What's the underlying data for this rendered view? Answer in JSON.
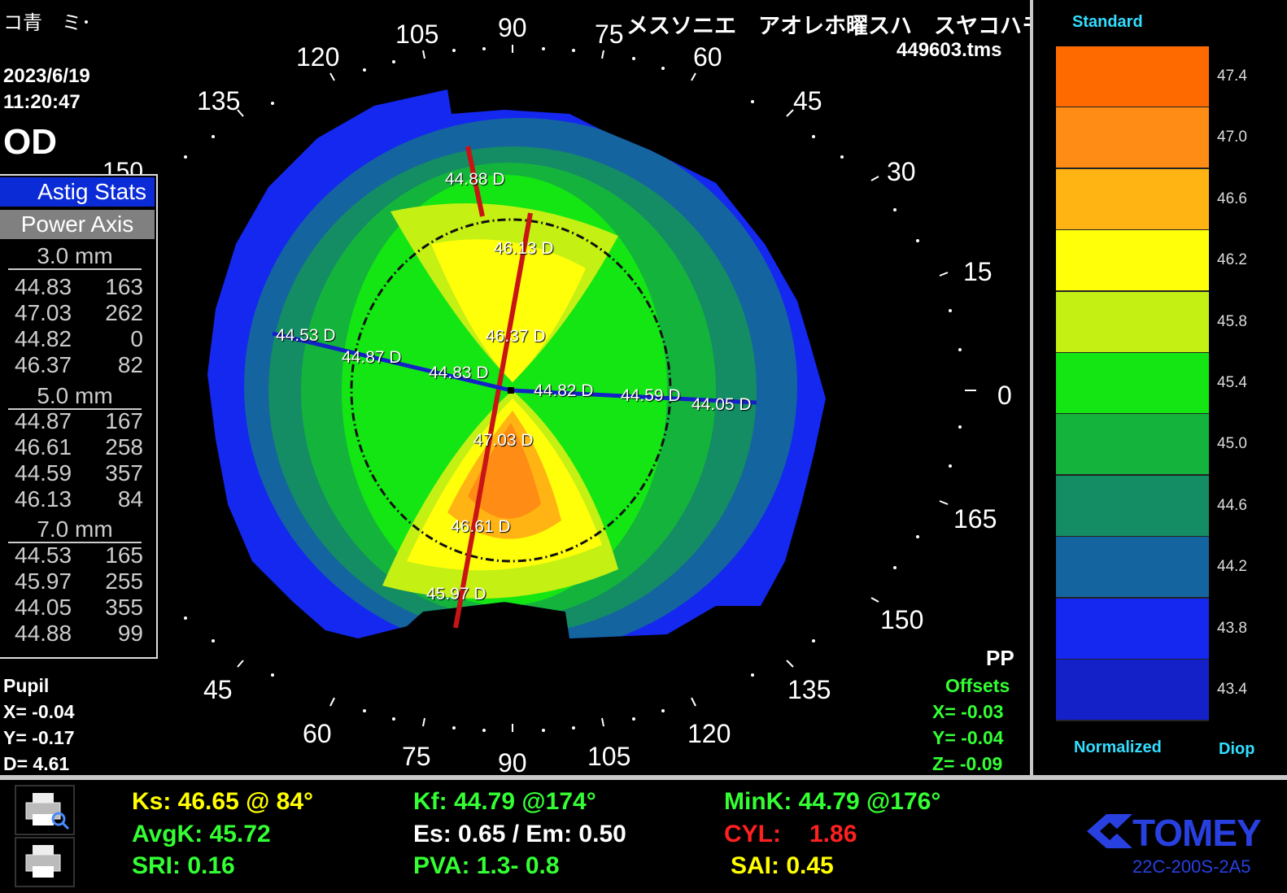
{
  "header": {
    "top_left_label": "コ青　ミ･",
    "top_right_label": "メスソニエ　アオレホ曜スハ　スヤコハモケ籔ミミト",
    "filename": "449603.tms",
    "date": "2023/6/19",
    "time": "11:20:47",
    "eye": "OD"
  },
  "astig_panel": {
    "title": "Astig Stats",
    "subtitle": "Power  Axis",
    "sections": [
      {
        "label": "3.0 mm",
        "rows": [
          [
            "44.83",
            "163"
          ],
          [
            "47.03",
            "262"
          ],
          [
            "44.82",
            "0"
          ],
          [
            "46.37",
            "82"
          ]
        ]
      },
      {
        "label": "5.0 mm",
        "rows": [
          [
            "44.87",
            "167"
          ],
          [
            "46.61",
            "258"
          ],
          [
            "44.59",
            "357"
          ],
          [
            "46.13",
            "84"
          ]
        ]
      },
      {
        "label": "7.0 mm",
        "rows": [
          [
            "44.53",
            "165"
          ],
          [
            "45.97",
            "255"
          ],
          [
            "44.05",
            "355"
          ],
          [
            "44.88",
            "99"
          ]
        ]
      }
    ]
  },
  "pupil": {
    "title": "Pupil",
    "x": "X= -0.04",
    "y": "Y= -0.17",
    "d": "D=  4.61"
  },
  "pp": {
    "title": "PP",
    "subtitle": "Offsets",
    "x": "X= -0.03",
    "y": "Y= -0.04",
    "z": "Z= -0.09"
  },
  "scale": {
    "top_label": "Standard",
    "bottom_left_label": "Normalized",
    "bottom_right_label": "Diop",
    "levels": [
      {
        "value": "47.4",
        "color": "#ff6a00"
      },
      {
        "value": "47.0",
        "color": "#ff8c14"
      },
      {
        "value": "46.6",
        "color": "#ffb414"
      },
      {
        "value": "46.2",
        "color": "#ffff0a"
      },
      {
        "value": "45.8",
        "color": "#c4f014"
      },
      {
        "value": "45.4",
        "color": "#14e614"
      },
      {
        "value": "45.0",
        "color": "#14b43c"
      },
      {
        "value": "44.6",
        "color": "#148c64"
      },
      {
        "value": "44.2",
        "color": "#1464a0"
      },
      {
        "value": "43.8",
        "color": "#1428f0"
      },
      {
        "value": "43.4",
        "color": "#1420c8"
      }
    ]
  },
  "angles_top": [
    "105",
    "90",
    "75",
    "120",
    "60",
    "135",
    "45",
    "150",
    "30",
    "15",
    "0",
    "165",
    "150",
    "135",
    "120",
    "45",
    "60",
    "75",
    "90",
    "105"
  ],
  "map_labels": [
    "44.88 D",
    "46.13 D",
    "44.53 D",
    "44.87 D",
    "46.37 D",
    "44.83 D",
    "44.82 D",
    "44.59 D",
    "44.05 D",
    "47.03 D",
    "46.61 D",
    "45.97 D"
  ],
  "indices": {
    "ks": "Ks: 46.65 @ 84°",
    "kf": "Kf: 44.79 @174°",
    "mink": "MinK: 44.79 @176°",
    "avgk": "AvgK: 45.72",
    "es_em": "Es: 0.65 / Em: 0.50",
    "cyl_label": "CYL:",
    "cyl_value": "1.86",
    "sri": "SRI: 0.16",
    "pva": "PVA:   1.3-  0.8",
    "sai": "SAI: 0.45"
  },
  "brand": {
    "name": "TOMEY",
    "model": "22C-200S-2A5"
  },
  "colors": {
    "ks": "#ffff00",
    "green_text": "#33ff33",
    "cyl": "#ff2020",
    "cyan": "#33ddff",
    "brand_blue": "#2840e0"
  }
}
